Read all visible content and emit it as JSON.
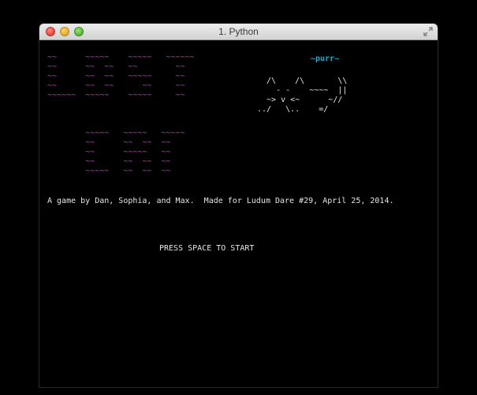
{
  "window": {
    "title": "1. Python"
  },
  "art": {
    "logo_top": "~~      ~~~~~    ~~~~~   ~~~~~~\n~~      ~~  ~~   ~~        ~~\n~~      ~~  ~~   ~~~~~     ~~\n~~      ~~  ~~      ~~     ~~\n~~~~~~  ~~~~~    ~~~~~     ~~",
    "logo_bottom": "        ~~~~~   ~~~~~   ~~~~~\n        ~~      ~~  ~~  ~~\n        ~~      ~~~~~   ~~\n        ~~      ~~  ~~  ~~\n        ~~~~~   ~~  ~~  ~~",
    "purr": "~purr~",
    "cat": "  /\\    /\\       \\\\\n    - -    ~~~~  ||\n  ~> v <~      ~//\n../   \\..    =/"
  },
  "text": {
    "credits": "A game by Dan, Sophia, and Max.  Made for Ludum Dare #29, April 25, 2014.",
    "press_start": "PRESS SPACE TO START"
  },
  "colors": {
    "logo": "#cc33cc",
    "purr": "#22aacc",
    "text": "#e6e6e6",
    "background": "#000000"
  },
  "icons": {
    "close": "close-icon",
    "minimize": "minimize-icon",
    "maximize": "maximize-icon",
    "fullscreen": "fullscreen-icon"
  }
}
